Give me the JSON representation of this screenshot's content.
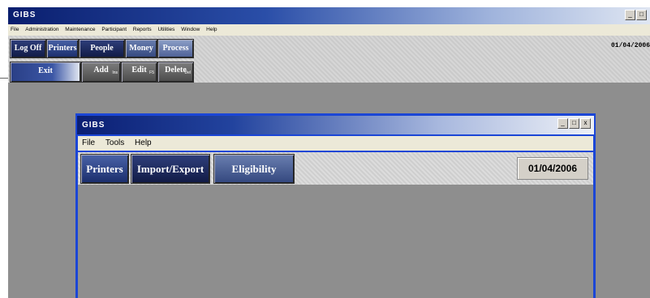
{
  "main_window": {
    "title": "GIBS",
    "controls": [
      "_",
      "□"
    ],
    "menu": [
      "File",
      "Administration",
      "Maintenance",
      "Participant",
      "Reports",
      "Utilities",
      "Window",
      "Help"
    ],
    "toolbar_row1": [
      "Log Off",
      "Printers",
      "People",
      "Money",
      "Process"
    ],
    "toolbar_row2": [
      {
        "label": "Exit",
        "sub": ""
      },
      {
        "label": "Add",
        "sub": "Ins"
      },
      {
        "label": "Edit",
        "sub": "F5"
      },
      {
        "label": "Delete",
        "sub": "Del"
      }
    ],
    "date": "01/04/2006"
  },
  "child_window": {
    "title": "GIBS",
    "controls": [
      "_",
      "□",
      "x"
    ],
    "menu": [
      "File",
      "Tools",
      "Help"
    ],
    "toolbar": [
      "Printers",
      "Import/Export",
      "Eligibility"
    ],
    "date": "01/04/2006"
  },
  "colors": {
    "title_dark": "#0a1e6e",
    "child_border": "#1b46d6",
    "workspace": "#8e8e8e"
  }
}
